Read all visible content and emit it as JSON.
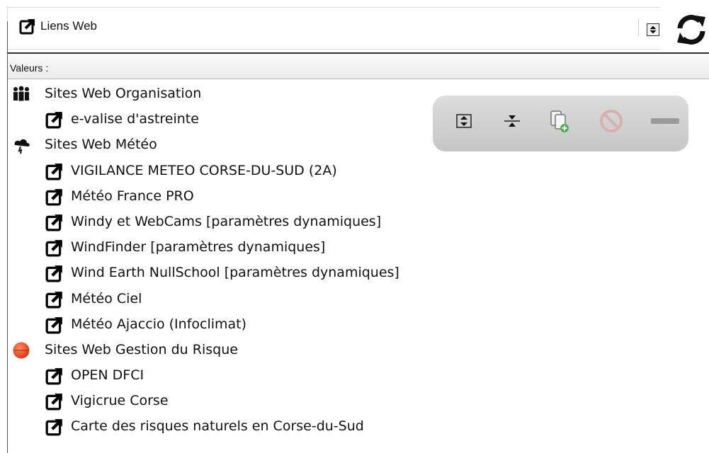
{
  "combo": {
    "icon": "external-link-icon",
    "label": "Liens Web",
    "spin_icon": "spin-updown-icon"
  },
  "refresh": {
    "icon": "refresh-icon"
  },
  "values_header": {
    "label": "Valeurs :"
  },
  "tree": {
    "groups": [
      {
        "icon": "people-group-icon",
        "label": "Sites Web Organisation",
        "items": [
          {
            "icon": "external-link-icon",
            "label": "e-valise d'astreinte"
          }
        ]
      },
      {
        "icon": "storm-cloud-icon",
        "label": "Sites Web Météo",
        "items": [
          {
            "icon": "external-link-icon",
            "label": "VIGILANCE METEO CORSE-DU-SUD (2A)"
          },
          {
            "icon": "external-link-icon",
            "label": "Météo France PRO"
          },
          {
            "icon": "external-link-icon",
            "label": "Windy et WebCams [paramètres dynamiques]"
          },
          {
            "icon": "external-link-icon",
            "label": "WindFinder [paramètres dynamiques]"
          },
          {
            "icon": "external-link-icon",
            "label": "Wind Earth NullSchool [paramètres dynamiques]"
          },
          {
            "icon": "external-link-icon",
            "label": "Météo Ciel"
          },
          {
            "icon": "external-link-icon",
            "label": "Météo Ajaccio (Infoclimat)"
          }
        ]
      },
      {
        "icon": "red-circle-icon",
        "label": "Sites Web Gestion du Risque",
        "items": [
          {
            "icon": "external-link-icon",
            "label": "OPEN DFCI"
          },
          {
            "icon": "external-link-icon",
            "label": "Vigicrue Corse"
          },
          {
            "icon": "external-link-icon",
            "label": "Carte des risques naturels en Corse-du-Sud"
          }
        ]
      }
    ]
  },
  "toolbar": {
    "buttons": [
      {
        "icon": "expand-all-icon"
      },
      {
        "icon": "collapse-all-icon"
      },
      {
        "icon": "copy-add-icon"
      },
      {
        "icon": "forbidden-icon"
      },
      {
        "icon": "minus-bar-icon"
      }
    ]
  },
  "colors": {
    "header_bg": "#f0f0f0",
    "toolbar_bg": "#cfcfcf",
    "risk_red": "#e3401c"
  }
}
